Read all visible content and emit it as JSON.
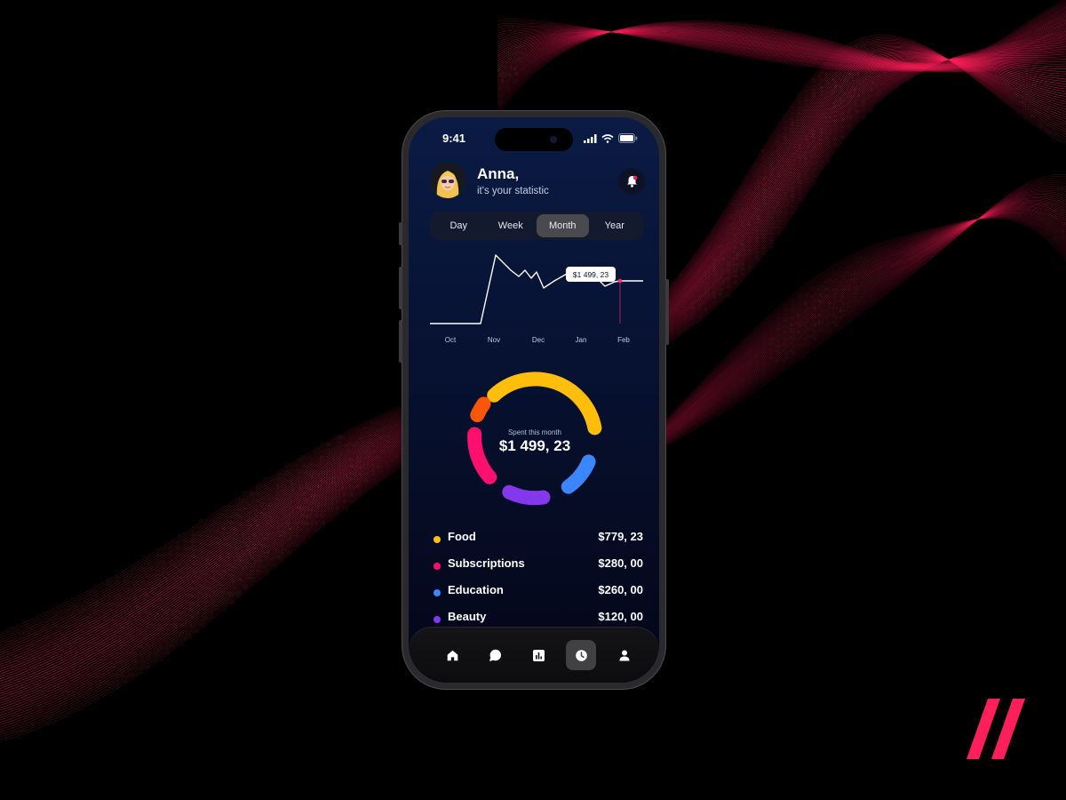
{
  "status_bar": {
    "time": "9:41"
  },
  "header": {
    "name": "Anna,",
    "subtitle": "it's your statistic"
  },
  "period_tabs": [
    {
      "label": "Day",
      "active": false
    },
    {
      "label": "Week",
      "active": false
    },
    {
      "label": "Month",
      "active": true
    },
    {
      "label": "Year",
      "active": false
    }
  ],
  "line_chart": {
    "months": [
      "Oct",
      "Nov",
      "Dec",
      "Jan",
      "Feb"
    ],
    "tooltip": "$1 499, 23",
    "line_color": "#ffffff",
    "marker_color": "#ff2d6f"
  },
  "chart_data": {
    "type": "line",
    "x": [
      "Oct",
      "Nov",
      "Dec",
      "Jan",
      "Feb"
    ],
    "tooltip_value": "$1 499, 23"
  },
  "donut": {
    "caption": "Spent this month",
    "total": "$1 499, 23"
  },
  "categories": [
    {
      "name": "Food",
      "amount": "$779, 23",
      "color": "#ffbe0b"
    },
    {
      "name": "Subscriptions",
      "amount": "$280, 00",
      "color": "#ff0f6e"
    },
    {
      "name": "Education",
      "amount": "$260, 00",
      "color": "#3a86ff"
    },
    {
      "name": "Beauty",
      "amount": "$120, 00",
      "color": "#8338ec"
    }
  ],
  "donut_extra_color": "#fb5607",
  "bottom_nav": [
    {
      "icon": "home-icon",
      "active": false
    },
    {
      "icon": "chat-icon",
      "active": false
    },
    {
      "icon": "bar-chart-icon",
      "active": false
    },
    {
      "icon": "clock-icon",
      "active": true
    },
    {
      "icon": "profile-icon",
      "active": false
    }
  ],
  "accent_color": "#ff1f5a"
}
